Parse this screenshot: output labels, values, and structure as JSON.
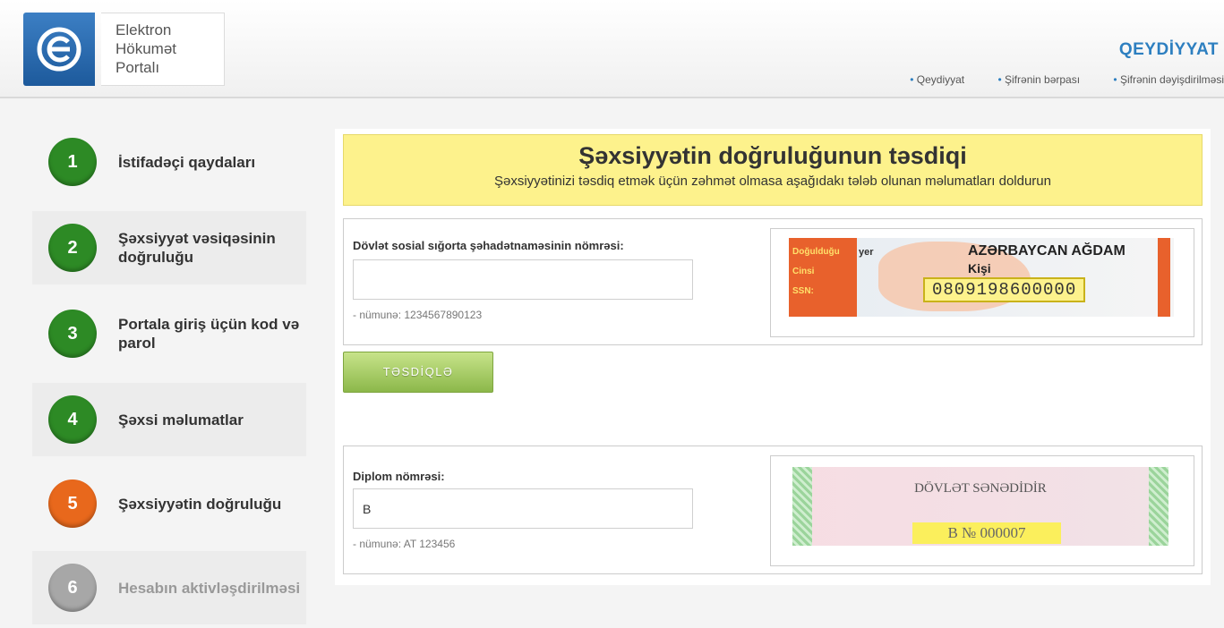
{
  "header": {
    "logo_lines": [
      "Elektron",
      "Hökumət",
      "Portalı"
    ],
    "title": "QEYDİYYAT",
    "links": [
      "Qeydiyyat",
      "Şifrənin bərpası",
      "Şifrənin dəyişdirilməsi"
    ]
  },
  "steps": [
    {
      "num": "1",
      "label": "İstifadəçi qaydaları",
      "state": "done"
    },
    {
      "num": "2",
      "label": "Şəxsiyyət vəsiqəsinin doğruluğu",
      "state": "done"
    },
    {
      "num": "3",
      "label": "Portala giriş üçün kod və parol",
      "state": "done"
    },
    {
      "num": "4",
      "label": "Şəxsi məlumatlar",
      "state": "done"
    },
    {
      "num": "5",
      "label": "Şəxsiyyətin doğruluğu",
      "state": "current"
    },
    {
      "num": "6",
      "label": "Hesabın aktivləşdirilməsi",
      "state": "pending"
    }
  ],
  "banner": {
    "title": "Şəxsiyyətin doğruluğunun təsdiqi",
    "subtitle": "Şəxsiyyətinizi təsdiq etmək üçün zəhmət olmasa aşağıdakı tələb olunan məlumatları doldurun"
  },
  "ssn_section": {
    "label": "Dövlət sosial sığorta şəhadətnaməsinin nömrəsi:",
    "value": "",
    "hint": "- nümunə: 1234567890123",
    "card": {
      "birth_label": "Doğulduğu",
      "yer": "yer",
      "gender_label": "Cinsi",
      "ssn_label": "SSN:",
      "place": "AZƏRBAYCAN AĞDAM",
      "sex": "Kişi",
      "ssn": "0809198600000"
    }
  },
  "confirm_button": "TƏSDİQLƏ",
  "diploma_section": {
    "label": "Diplom nömrəsi:",
    "value": "B",
    "hint": "- nümunə: AT 123456",
    "sample_title": "DÖVLƏT SƏNƏDİDİR",
    "sample_number": "B № 000007"
  },
  "colors": {
    "accent_blue": "#2d7fc0",
    "step_done": "#2d8a25",
    "step_current": "#e8681c",
    "step_pending": "#a7a7a7",
    "banner_bg": "#fdf28c",
    "button_green": "#8cb84a"
  }
}
